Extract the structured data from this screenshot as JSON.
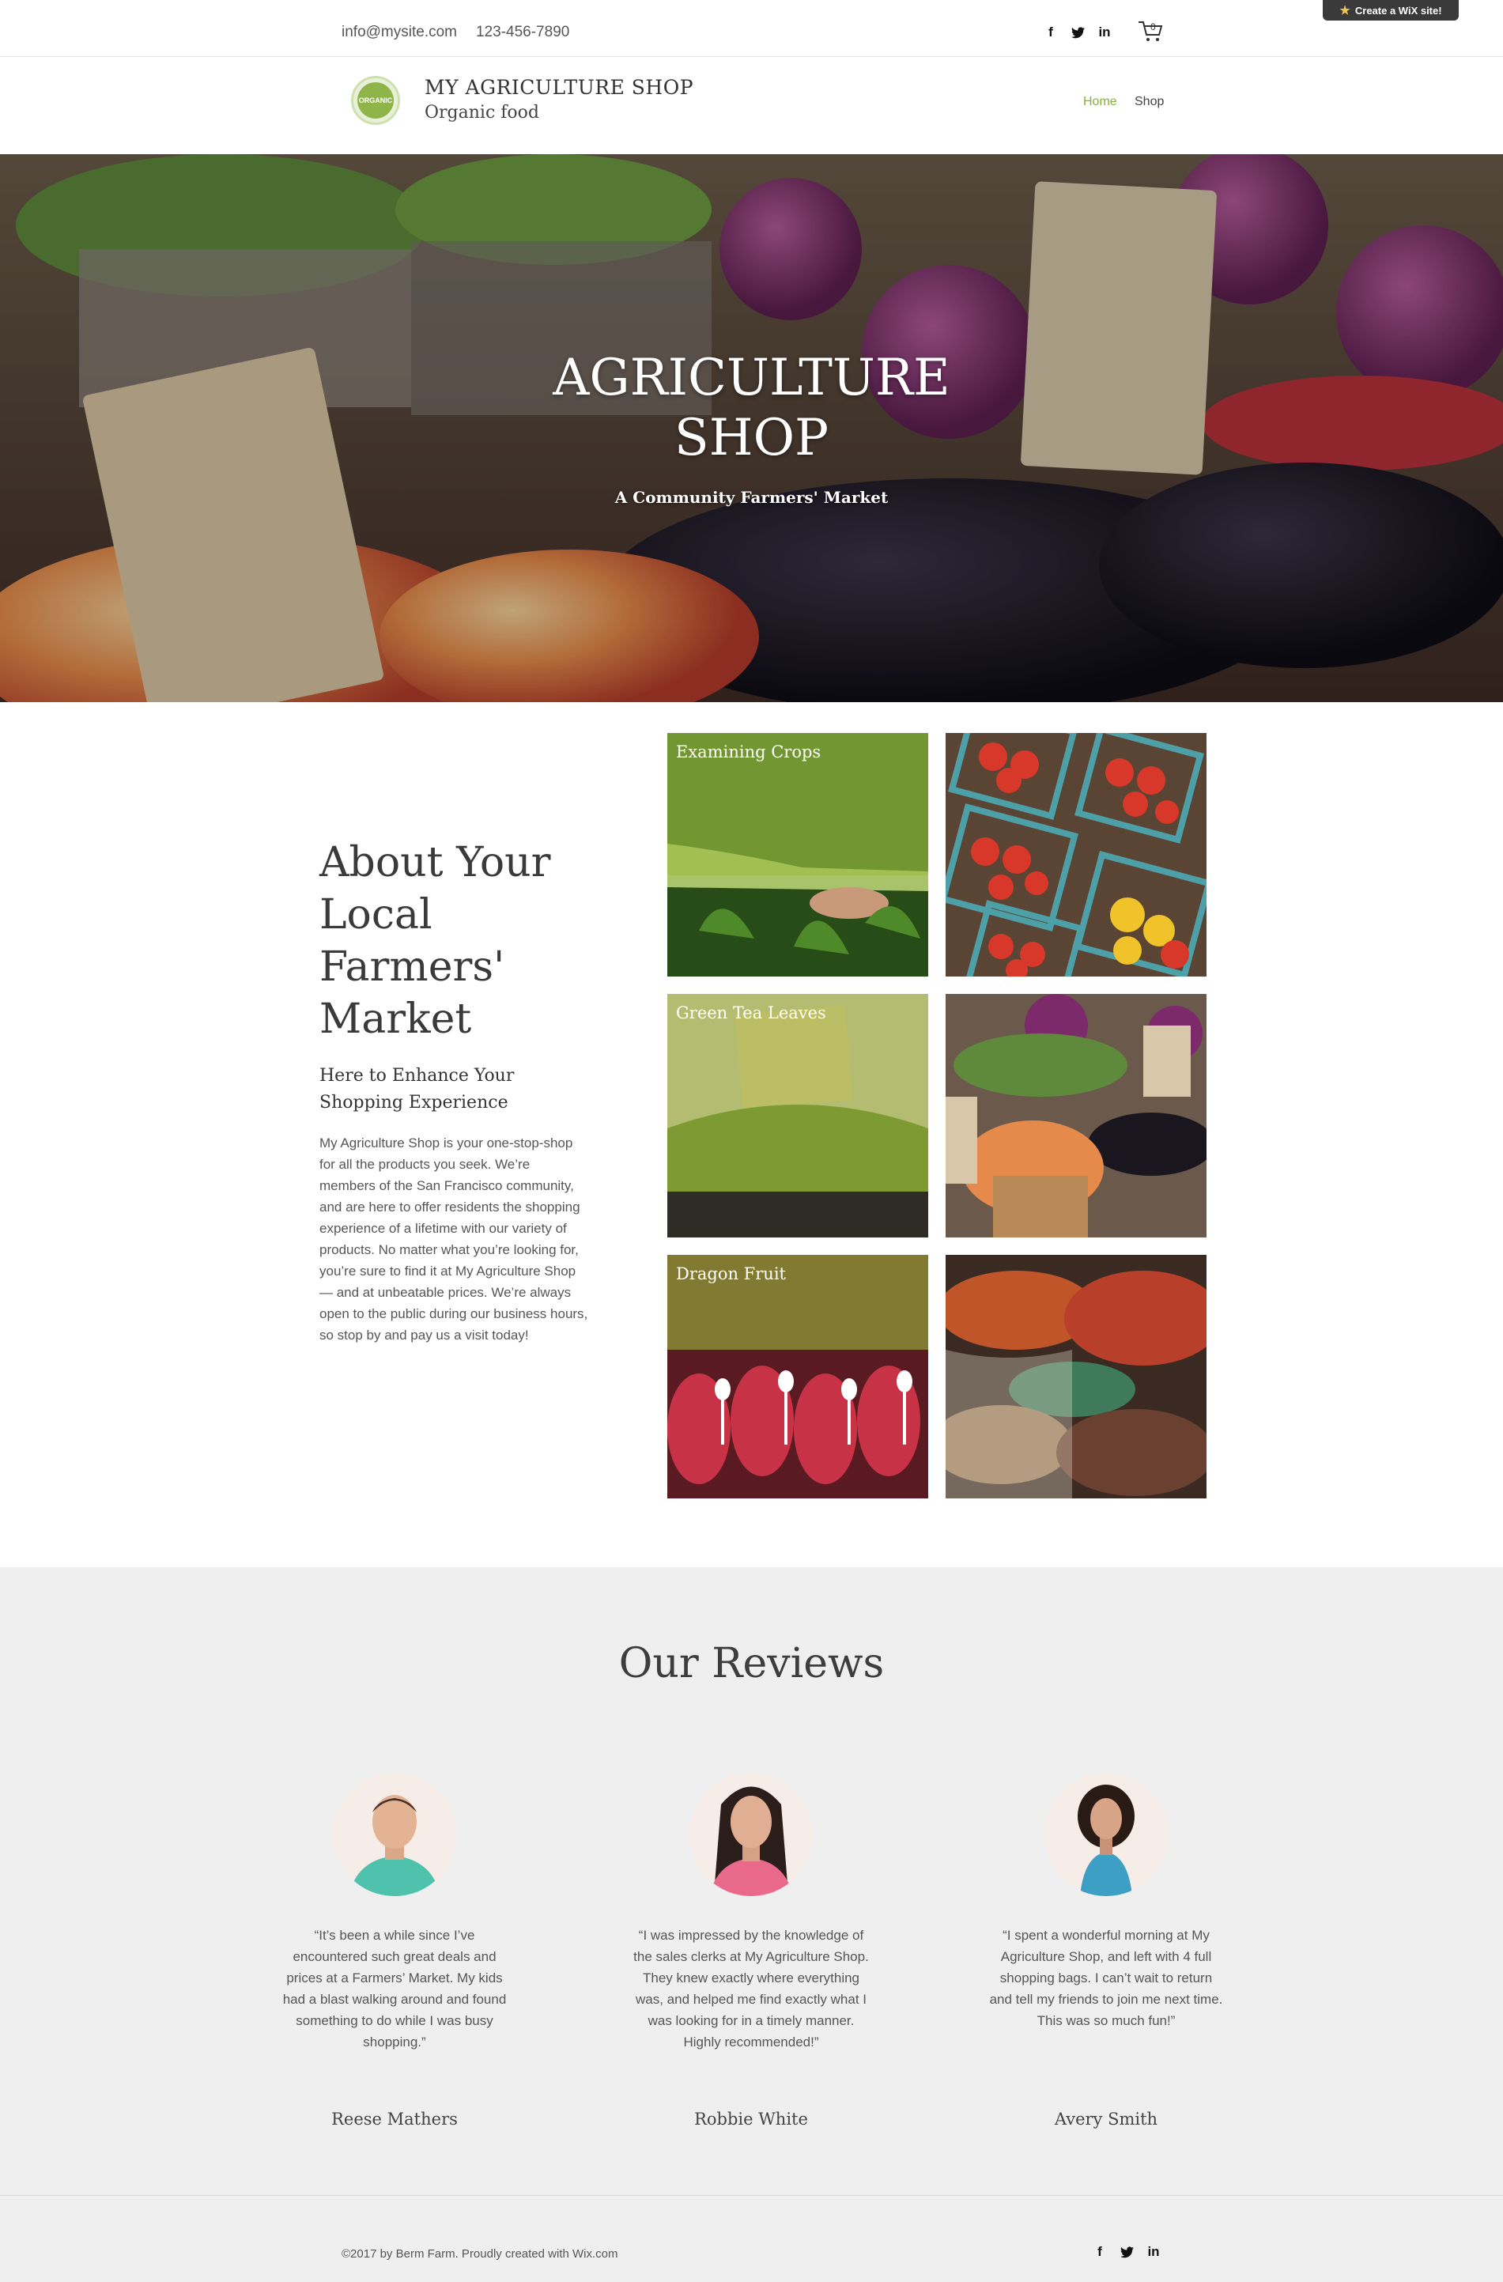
{
  "topbar": {
    "email": "info@mysite.com",
    "phone": "123-456-7890",
    "social": [
      {
        "icon": "facebook-icon",
        "glyph": "f"
      },
      {
        "icon": "twitter-icon",
        "glyph": "🐦"
      },
      {
        "icon": "linkedin-icon",
        "glyph": "in"
      }
    ],
    "cart_count": "0"
  },
  "wix_badge": {
    "label": "Create a WiX site!"
  },
  "header": {
    "logo_text": "ORGANIC",
    "title": "MY AGRICULTURE SHOP",
    "subtitle": "Organic food",
    "nav": {
      "home": "Home",
      "shop": "Shop"
    }
  },
  "hero": {
    "title_line1": "AGRICULTURE",
    "title_line2": "SHOP",
    "subtitle": "A Community Farmers' Market"
  },
  "about": {
    "title": "About Your Local Farmers' Market",
    "subtitle": "Here to Enhance Your Shopping Experience",
    "body": "My Agriculture Shop is your one-stop-shop for all the products you seek. We’re members of the San Francisco community, and are here to offer residents the shopping experience of a lifetime with our variety of products. No matter what you’re looking for, you’re sure to find it at My Agriculture Shop — and at unbeatable prices. We’re always open to the public during our business hours, so stop by and pay us a visit today!"
  },
  "gallery": {
    "labels": [
      "Examining Crops",
      "Green Tea Leaves",
      "Dragon Fruit"
    ]
  },
  "reviews": {
    "title": "Our Reviews",
    "items": [
      {
        "quote": "“It’s been a while since I’ve encountered such great deals and prices at a Farmers’ Market. My kids had a blast walking around and found something to do while I was busy shopping.”",
        "name": "Reese Mathers"
      },
      {
        "quote": "“I was impressed by the knowledge of the sales clerks at My Agriculture Shop. They knew exactly where everything was, and helped me find exactly what I was looking for in a timely manner. Highly recommended!”",
        "name": "Robbie White"
      },
      {
        "quote": "“I spent a wonderful morning at My Agriculture Shop, and left with 4 full shopping bags. I can’t wait to return and tell my friends to join me next time. This was so much fun!”",
        "name": "Avery Smith"
      }
    ]
  },
  "footer": {
    "copyright": "©2017 by Berm Farm. Proudly created with Wix.com"
  },
  "colors": {
    "accent": "#8aae3d",
    "reviews_bg": "#efefef",
    "text": "#333333"
  }
}
